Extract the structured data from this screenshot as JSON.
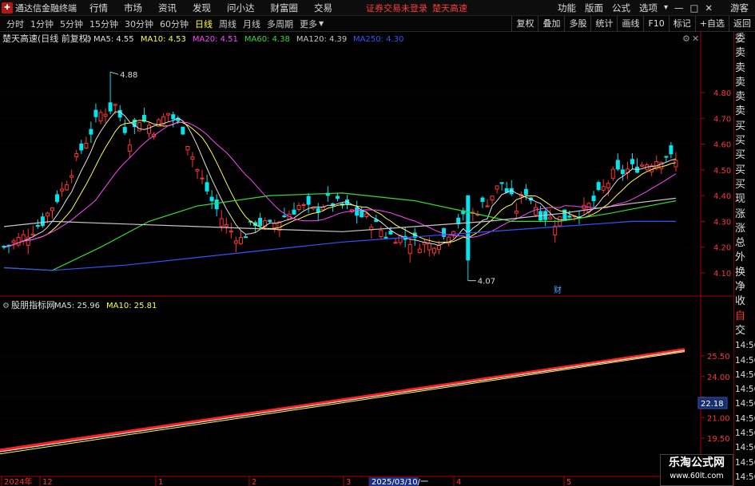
{
  "menubar": {
    "app_name": "通达信金融终端",
    "items": [
      "行情",
      "市场",
      "资讯",
      "发现",
      "问小达",
      "财富圈",
      "交易"
    ],
    "notice": "证券交易未登录",
    "stock_name": "楚天高速",
    "right_items": [
      "功能",
      "版面",
      "公式",
      "选项"
    ],
    "user": "游客"
  },
  "toolbar": {
    "timeframes": [
      "分时",
      "1分钟",
      "5分钟",
      "15分钟",
      "30分钟",
      "60分钟",
      "日线",
      "周线",
      "月线",
      "多周期",
      "更多"
    ],
    "active_timeframe": "日线",
    "buttons": [
      "复权",
      "叠加",
      "多股",
      "统计",
      "画线",
      "F10",
      "标记",
      "+自选",
      "返回"
    ]
  },
  "main_panel": {
    "title": "楚天高速(日线 前复权)",
    "ma_labels": [
      {
        "text": "MA5: 4.55",
        "color": "#e0e0e0"
      },
      {
        "text": "MA10: 4.53",
        "color": "#ffff44"
      },
      {
        "text": "MA20: 4.51",
        "color": "#ff44ff"
      },
      {
        "text": "MA60: 4.38",
        "color": "#33dd33"
      },
      {
        "text": "MA120: 4.39",
        "color": "#c8c8c8"
      },
      {
        "text": "MA250: 4.30",
        "color": "#3355ff"
      }
    ],
    "y_ticks": [
      4.8,
      4.7,
      4.6,
      4.5,
      4.4,
      4.3,
      4.2,
      4.1
    ],
    "y_tick_labels": [
      "4.80",
      "4.70",
      "4.60",
      "4.50",
      "4.40",
      "4.30",
      "4.20",
      "4.10"
    ],
    "high_label": "4.88",
    "low_label": "4.07",
    "finance_marker": "财"
  },
  "sub_panel": {
    "title": "股朋指标网",
    "ma_labels": [
      {
        "text": "MA5: 25.96",
        "color": "#e0e0e0"
      },
      {
        "text": "MA10: 25.81",
        "color": "#ffff44"
      }
    ],
    "y_ticks": [
      25.5,
      24.0,
      22.5,
      21.0,
      19.5
    ],
    "y_tick_labels": [
      "25.50",
      "24.00",
      "22.18",
      "21.00",
      "19.50"
    ],
    "current_value": "22.18"
  },
  "x_axis": {
    "labels": [
      "2024年",
      "12",
      "1",
      "2",
      "3",
      "2025/03/10/一",
      "4",
      "5"
    ]
  },
  "right_panel": {
    "items": [
      "委比",
      "卖五",
      "卖四",
      "卖三",
      "卖二",
      "卖一",
      "买一",
      "买二",
      "买三",
      "买四",
      "买五",
      "现价",
      "涨跌",
      "涨幅",
      "总量",
      "外盘",
      "换手",
      "净资",
      "收益",
      "自动",
      "交易",
      "14:56",
      "14:56",
      "14:56",
      "14:56",
      "14:56",
      "14:56",
      "14:56",
      "14:56",
      "14:56",
      "14:56"
    ]
  },
  "watermark": {
    "line1": "乐淘公式网",
    "line2": "www.60lt.com"
  },
  "colors": {
    "up": "#ff3333",
    "down": "#00e5ee",
    "axis_red": "#b00000",
    "grid": "#5a0000"
  }
}
